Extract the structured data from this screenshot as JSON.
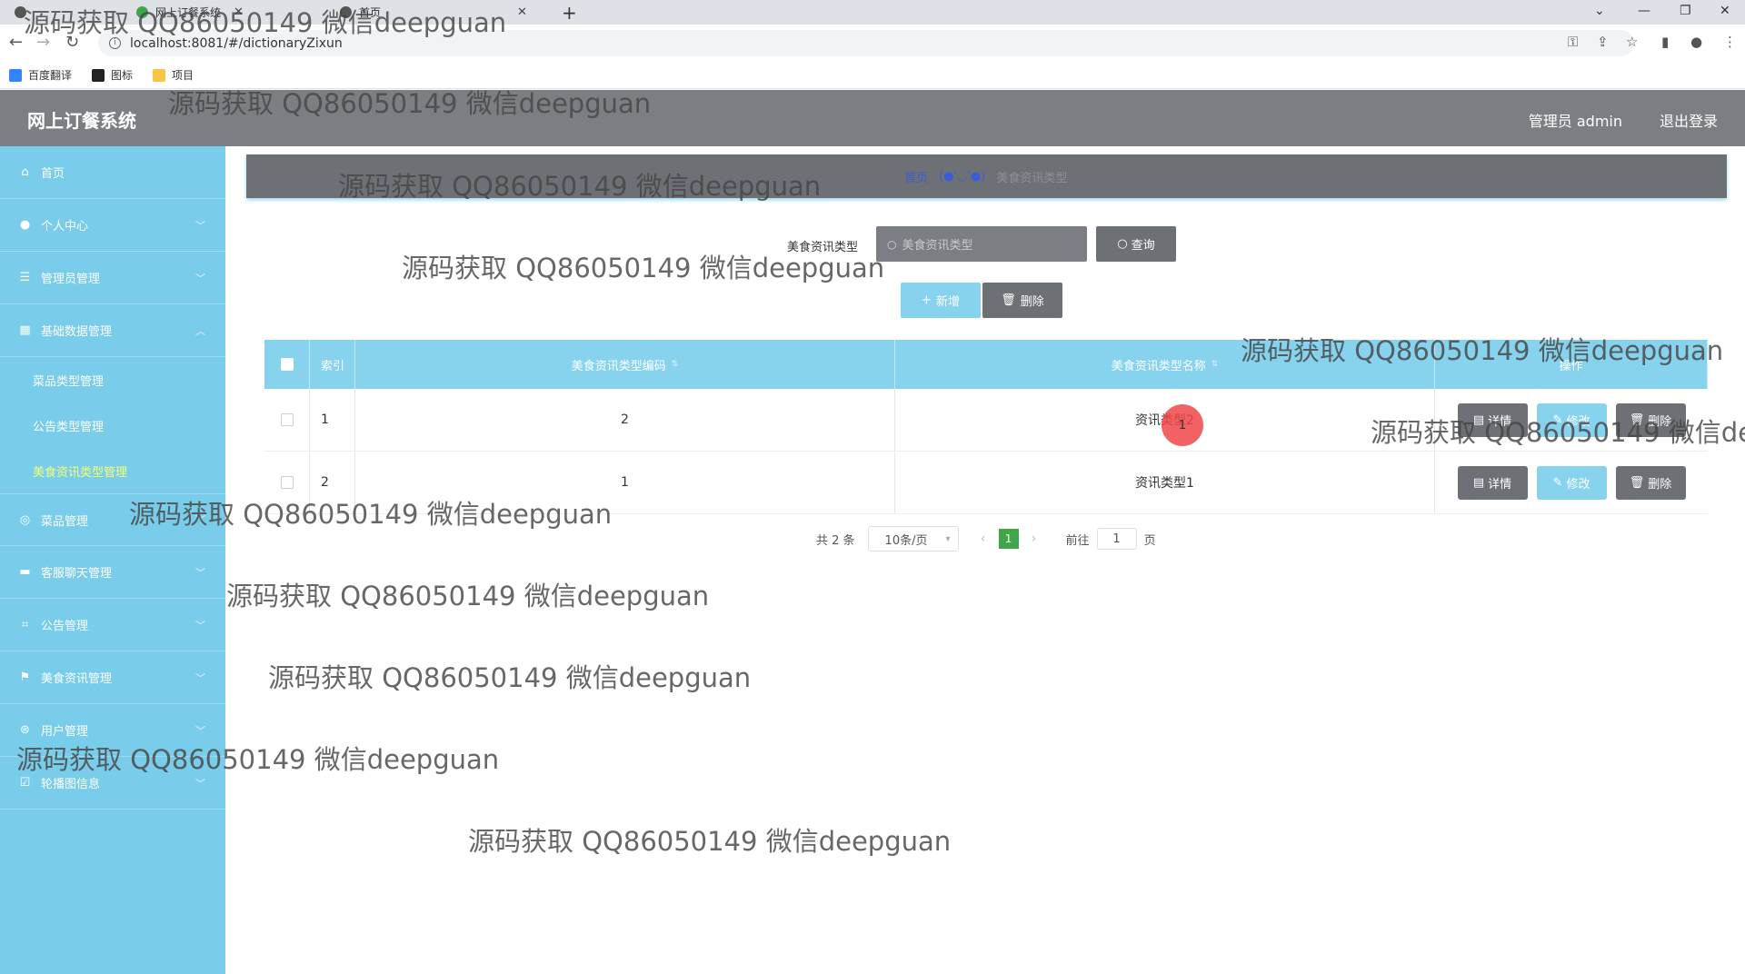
{
  "browser": {
    "tabs": [
      {
        "title": ""
      },
      {
        "title": "网上订餐系统"
      },
      {
        "title": "首页"
      }
    ],
    "url": "localhost:8081/#/dictionaryZixun",
    "bookmarks": [
      {
        "label": "百度翻译",
        "color": "#3385ff"
      },
      {
        "label": "图标",
        "color": "#222222"
      },
      {
        "label": "项目",
        "color": "#f6c644"
      }
    ]
  },
  "header": {
    "title": "网上订餐系统",
    "user": "管理员 admin",
    "logout": "退出登录"
  },
  "sidebar": {
    "items": [
      {
        "label": "首页",
        "icon": "home-icon"
      },
      {
        "label": "个人中心",
        "icon": "user-icon"
      },
      {
        "label": "管理员管理",
        "icon": "list-icon"
      },
      {
        "label": "基础数据管理",
        "icon": "grid-icon"
      },
      {
        "label": "菜品管理",
        "icon": "globe-icon"
      },
      {
        "label": "客服聊天管理",
        "icon": "monitor-icon"
      },
      {
        "label": "公告管理",
        "icon": "crop-icon"
      },
      {
        "label": "美食资讯管理",
        "icon": "flag-icon"
      },
      {
        "label": "用户管理",
        "icon": "compass-icon"
      },
      {
        "label": "轮播图信息",
        "icon": "check-icon"
      }
    ],
    "submenu": [
      {
        "label": "菜品类型管理"
      },
      {
        "label": "公告类型管理"
      },
      {
        "label": "美食资讯类型管理"
      }
    ]
  },
  "breadcrumb": {
    "home": "首页",
    "separator": "(●'◡'●)",
    "current": "美食资讯类型"
  },
  "search": {
    "label": "美食资讯类型",
    "placeholder": "美食资讯类型",
    "button": "查询"
  },
  "actions": {
    "add": "新增",
    "delete": "删除"
  },
  "table": {
    "headers": {
      "index": "索引",
      "code": "美食资讯类型编码",
      "name": "美食资讯类型名称",
      "op": "操作"
    },
    "rows": [
      {
        "index": "1",
        "code": "2",
        "name": "资讯类型2"
      },
      {
        "index": "2",
        "code": "1",
        "name": "资讯类型1"
      }
    ],
    "op_labels": {
      "detail": "详情",
      "edit": "修改",
      "delete": "删除"
    }
  },
  "pager": {
    "total": "共 2 条",
    "page_size": "10条/页",
    "current": "1",
    "goto_label": "前往",
    "goto_value": "1",
    "page_suffix": "页"
  },
  "click_marker": "1",
  "watermark": "源码获取 QQ86050149 微信deepguan",
  "colors": {
    "header": "#7b7e82",
    "sidebar": "#79cdea",
    "table_header": "#87d3ee",
    "button_dark": "#6d7074",
    "pager_active": "#3fa64a",
    "active_submenu": "#f5ff6e"
  }
}
